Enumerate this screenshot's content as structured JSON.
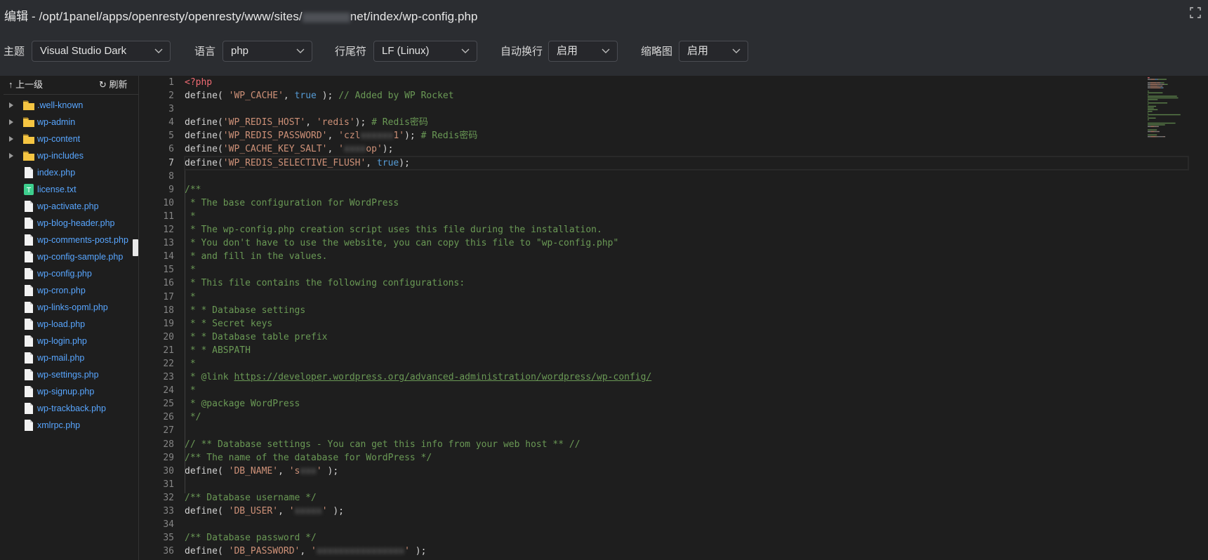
{
  "header": {
    "title_prefix": "编辑 - /opt/1panel/apps/openresty/openresty/www/sites/",
    "title_suffix": "net/index/wp-config.php",
    "fullscreen_icon": "fullscreen-icon"
  },
  "toolbar": {
    "theme_label": "主题",
    "theme_value": "Visual Studio Dark",
    "language_label": "语言",
    "language_value": "php",
    "eol_label": "行尾符",
    "eol_value": "LF (Linux)",
    "wrap_label": "自动换行",
    "wrap_value": "启用",
    "minimap_label": "缩略图",
    "minimap_value": "启用"
  },
  "sidebar": {
    "up_label": "上一级",
    "refresh_label": "刷新",
    "items": [
      {
        "name": ".well-known",
        "type": "folder"
      },
      {
        "name": "wp-admin",
        "type": "folder"
      },
      {
        "name": "wp-content",
        "type": "folder"
      },
      {
        "name": "wp-includes",
        "type": "folder"
      },
      {
        "name": "index.php",
        "type": "file"
      },
      {
        "name": "license.txt",
        "type": "text"
      },
      {
        "name": "wp-activate.php",
        "type": "file"
      },
      {
        "name": "wp-blog-header.php",
        "type": "file"
      },
      {
        "name": "wp-comments-post.php",
        "type": "file"
      },
      {
        "name": "wp-config-sample.php",
        "type": "file"
      },
      {
        "name": "wp-config.php",
        "type": "file"
      },
      {
        "name": "wp-cron.php",
        "type": "file"
      },
      {
        "name": "wp-links-opml.php",
        "type": "file"
      },
      {
        "name": "wp-load.php",
        "type": "file"
      },
      {
        "name": "wp-login.php",
        "type": "file"
      },
      {
        "name": "wp-mail.php",
        "type": "file"
      },
      {
        "name": "wp-settings.php",
        "type": "file"
      },
      {
        "name": "wp-signup.php",
        "type": "file"
      },
      {
        "name": "wp-trackback.php",
        "type": "file"
      },
      {
        "name": "xmlrpc.php",
        "type": "file"
      }
    ]
  },
  "editor": {
    "current_line": 7,
    "lines": [
      [
        [
          "tag",
          "<?php"
        ]
      ],
      [
        [
          "",
          "define( "
        ],
        [
          "str",
          "'WP_CACHE'"
        ],
        [
          "",
          ", "
        ],
        [
          "kw",
          "true"
        ],
        [
          "",
          " ); "
        ],
        [
          "com",
          "// Added by WP Rocket"
        ]
      ],
      [],
      [
        [
          "",
          "define("
        ],
        [
          "str",
          "'WP_REDIS_HOST'"
        ],
        [
          "",
          ", "
        ],
        [
          "str",
          "'redis'"
        ],
        [
          "",
          "); "
        ],
        [
          "com",
          "# Redis密码"
        ]
      ],
      [
        [
          "",
          "define("
        ],
        [
          "str",
          "'WP_REDIS_PASSWORD'"
        ],
        [
          "",
          ", "
        ],
        [
          "str",
          "'czl"
        ],
        [
          "blur",
          "xxxxxx"
        ],
        [
          "str",
          "1'"
        ],
        [
          "",
          "); "
        ],
        [
          "com",
          "# Redis密码"
        ]
      ],
      [
        [
          "",
          "define("
        ],
        [
          "str",
          "'WP_CACHE_KEY_SALT'"
        ],
        [
          "",
          ", "
        ],
        [
          "str",
          "'"
        ],
        [
          "blur",
          "xxxx"
        ],
        [
          "str",
          "op'"
        ],
        [
          "",
          ");"
        ]
      ],
      [
        [
          "",
          "define("
        ],
        [
          "str",
          "'WP_REDIS_SELECTIVE_FLUSH'"
        ],
        [
          "",
          ", "
        ],
        [
          "kw",
          "true"
        ],
        [
          "",
          ");"
        ]
      ],
      [],
      [
        [
          "com",
          "/**"
        ]
      ],
      [
        [
          "com",
          " * The base configuration for WordPress"
        ]
      ],
      [
        [
          "com",
          " *"
        ]
      ],
      [
        [
          "com",
          " * The wp-config.php creation script uses this file during the installation."
        ]
      ],
      [
        [
          "com",
          " * You don't have to use the website, you can copy this file to \"wp-config.php\""
        ]
      ],
      [
        [
          "com",
          " * and fill in the values."
        ]
      ],
      [
        [
          "com",
          " *"
        ]
      ],
      [
        [
          "com",
          " * This file contains the following configurations:"
        ]
      ],
      [
        [
          "com",
          " *"
        ]
      ],
      [
        [
          "com",
          " * * Database settings"
        ]
      ],
      [
        [
          "com",
          " * * Secret keys"
        ]
      ],
      [
        [
          "com",
          " * * Database table prefix"
        ]
      ],
      [
        [
          "com",
          " * * ABSPATH"
        ]
      ],
      [
        [
          "com",
          " *"
        ]
      ],
      [
        [
          "com",
          " * @link "
        ],
        [
          "lnk",
          "https://developer.wordpress.org/advanced-administration/wordpress/wp-config/"
        ]
      ],
      [
        [
          "com",
          " *"
        ]
      ],
      [
        [
          "com",
          " * @package WordPress"
        ]
      ],
      [
        [
          "com",
          " */"
        ]
      ],
      [],
      [
        [
          "com",
          "// ** Database settings - You can get this info from your web host ** //"
        ]
      ],
      [
        [
          "com",
          "/** The name of the database for WordPress */"
        ]
      ],
      [
        [
          "",
          "define( "
        ],
        [
          "str",
          "'DB_NAME'"
        ],
        [
          "",
          ", "
        ],
        [
          "str",
          "'s"
        ],
        [
          "blur",
          "xxx"
        ],
        [
          "str",
          "'"
        ],
        [
          "",
          " );"
        ]
      ],
      [],
      [
        [
          "com",
          "/** Database username */"
        ]
      ],
      [
        [
          "",
          "define( "
        ],
        [
          "str",
          "'DB_USER'"
        ],
        [
          "",
          ", "
        ],
        [
          "str",
          "'"
        ],
        [
          "blur",
          "xxxxx"
        ],
        [
          "str",
          "'"
        ],
        [
          "",
          " );"
        ]
      ],
      [],
      [
        [
          "com",
          "/** Database password */"
        ]
      ],
      [
        [
          "",
          "define( "
        ],
        [
          "str",
          "'DB_PASSWORD'"
        ],
        [
          "",
          ", "
        ],
        [
          "str",
          "'"
        ],
        [
          "blur",
          "xxxxxxxxxxxxxxxx"
        ],
        [
          "str",
          "'"
        ],
        [
          "",
          " );"
        ]
      ]
    ]
  },
  "colors": {
    "header_bg": "#2b2d31",
    "editor_bg": "#1e1e1e",
    "file_link": "#58a6ff",
    "folder": "#f5c542",
    "txt_icon": "#3ecf8e"
  }
}
